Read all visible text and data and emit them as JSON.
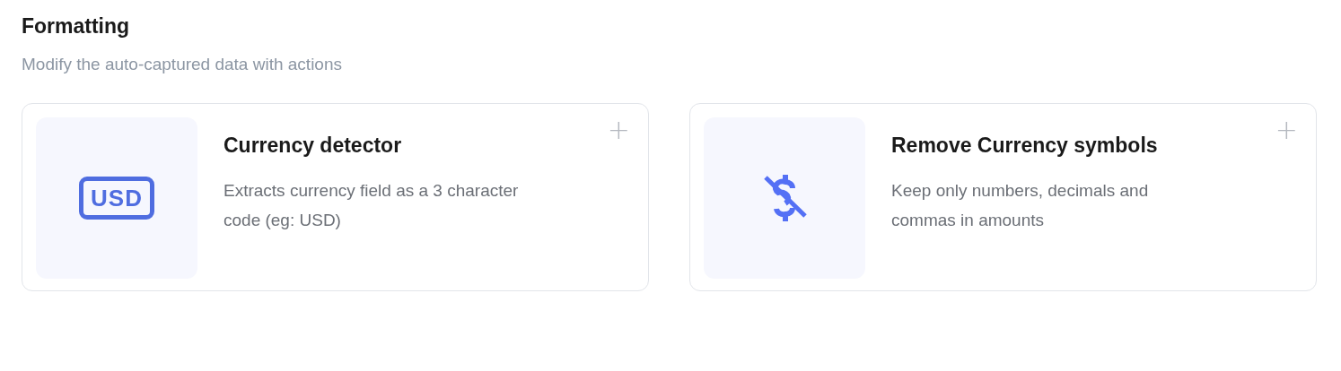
{
  "section": {
    "title": "Formatting",
    "subtitle": "Modify the auto-captured data with actions"
  },
  "cards": [
    {
      "kind": "badge",
      "badge_text": "USD",
      "title": "Currency detector",
      "description": "Extracts currency field as a 3 character code (eg: USD)",
      "add_icon": "+"
    },
    {
      "kind": "no-currency",
      "title": "Remove Currency symbols",
      "description": "Keep only numbers, decimals and commas in amounts",
      "add_icon": "+"
    }
  ]
}
